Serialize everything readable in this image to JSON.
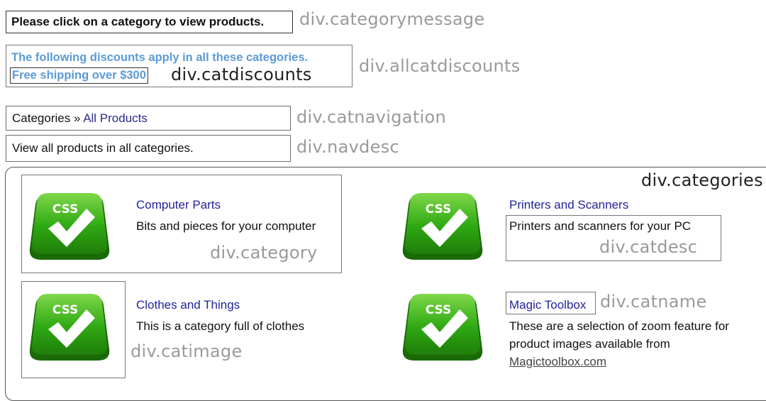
{
  "category_message": "Please click on a category to view products.",
  "annotations": {
    "categorymessage": "div.categorymessage",
    "allcatdiscounts": "div.allcatdiscounts",
    "catdiscounts": "div.catdiscounts",
    "catnavigation": "div.catnavigation",
    "navdesc": "div.navdesc",
    "categories": "div.categories",
    "category": "div.category",
    "catdesc": "div.catdesc",
    "catimage": "div.catimage",
    "catname": "div.catname"
  },
  "discounts": {
    "heading": "The following discounts apply in all these categories.",
    "item": "Free shipping over $300"
  },
  "navigation": {
    "root": "Categories",
    "separator": " » ",
    "current": "All Products"
  },
  "nav_description": "View all products in all categories.",
  "icon_text": "CSS",
  "colors": {
    "link": "#22229a",
    "discount": "#5b9bd5",
    "icon_green": "#2a9a10"
  },
  "categories": [
    {
      "name": "Computer Parts",
      "description": "Bits and pieces for your computer"
    },
    {
      "name": "Printers and Scanners",
      "description": "Printers and scanners for your PC"
    },
    {
      "name": "Clothes and Things",
      "description": "This is a category full of clothes"
    },
    {
      "name": "Magic Toolbox",
      "description": "These are a selection of zoom feature for product images available from",
      "link": "Magictoolbox.com"
    }
  ]
}
